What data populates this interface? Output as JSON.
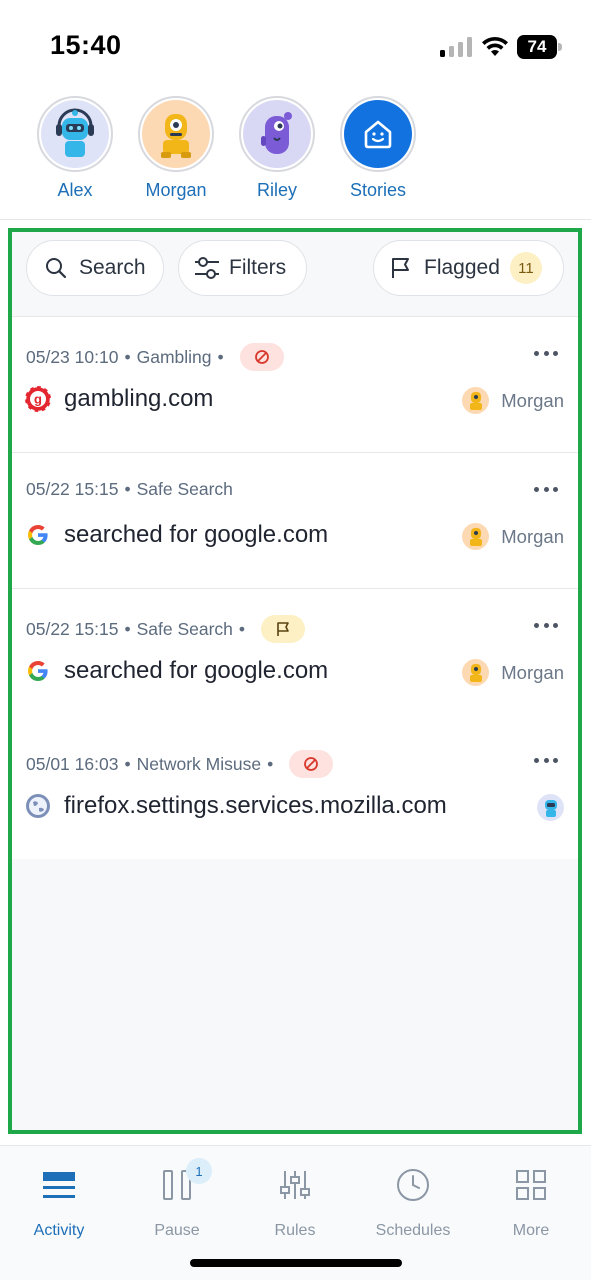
{
  "status_bar": {
    "time": "15:40",
    "battery": "74"
  },
  "profiles": [
    {
      "name": "Alex",
      "avatar": "robot-avatar-blue"
    },
    {
      "name": "Morgan",
      "avatar": "robot-avatar-orange"
    },
    {
      "name": "Riley",
      "avatar": "robot-avatar-purple"
    },
    {
      "name": "Stories",
      "avatar": "home-smile-icon"
    }
  ],
  "toolbar": {
    "search_label": "Search",
    "filters_label": "Filters",
    "flagged_label": "Flagged",
    "flagged_count": "11"
  },
  "activity": [
    {
      "date": "05/23 10:10",
      "category": "Gambling",
      "chip": "block-icon",
      "title": "gambling.com",
      "site_icon": "gambling-favicon",
      "owner": "Morgan"
    },
    {
      "date": "05/22 15:15",
      "category": "Safe Search",
      "chip": "",
      "title": "searched for google.com",
      "site_icon": "google-icon",
      "owner": "Morgan"
    },
    {
      "date": "05/22 15:15",
      "category": "Safe Search",
      "chip": "flag-icon",
      "title": "searched for google.com",
      "site_icon": "google-icon",
      "owner": "Morgan"
    },
    {
      "date": "05/01 16:03",
      "category": "Network Misuse",
      "chip": "block-icon",
      "title": "firefox.settings.services.mozilla.com",
      "site_icon": "globe-icon",
      "owner": ""
    }
  ],
  "tabs": [
    {
      "label": "Activity",
      "active": true
    },
    {
      "label": "Pause",
      "badge": "1"
    },
    {
      "label": "Rules"
    },
    {
      "label": "Schedules"
    },
    {
      "label": "More"
    }
  ],
  "colors": {
    "accent": "#1d6fb8",
    "highlight_frame": "#1fa84a",
    "block_chip": "#fde2df",
    "flag_chip": "#fdf0c4"
  }
}
